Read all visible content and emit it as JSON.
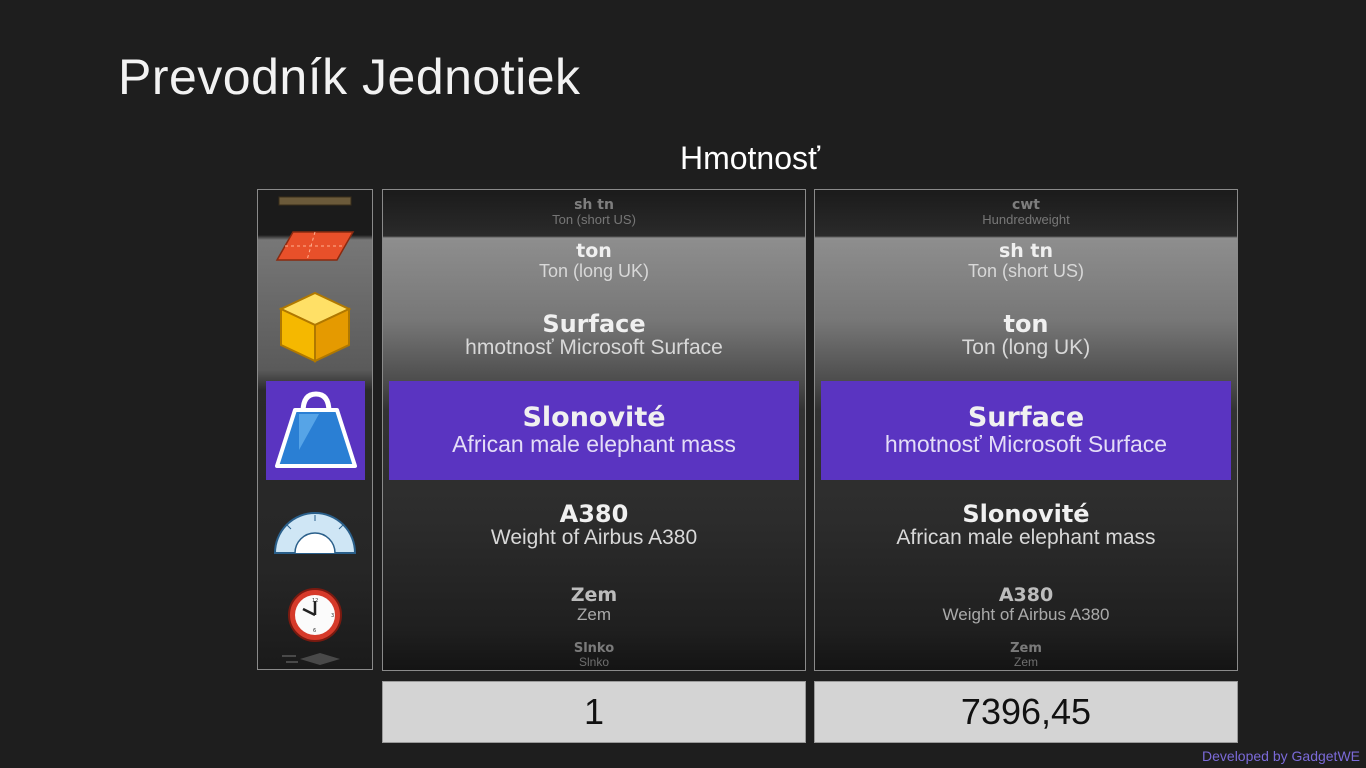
{
  "app": {
    "title": "Prevodník Jednotiek"
  },
  "category": {
    "title": "Hmotnosť"
  },
  "category_icons": [
    "ruler-icon",
    "area-icon",
    "volume-cube-icon",
    "weight-icon",
    "protractor-icon",
    "clock-icon",
    "speed-icon"
  ],
  "from_list": [
    {
      "abbr": "sh tn",
      "full": "Ton (short US)"
    },
    {
      "abbr": "ton",
      "full": "Ton (long UK)"
    },
    {
      "abbr": "Surface",
      "full": "hmotnosť Microsoft Surface"
    },
    {
      "abbr": "Slonovité",
      "full": "African male elephant mass"
    },
    {
      "abbr": "A380",
      "full": "Weight of Airbus A380"
    },
    {
      "abbr": "Zem",
      "full": "Zem"
    },
    {
      "abbr": "Slnko",
      "full": "Slnko"
    }
  ],
  "to_list": [
    {
      "abbr": "cwt",
      "full": "Hundredweight"
    },
    {
      "abbr": "sh tn",
      "full": "Ton (short US)"
    },
    {
      "abbr": "ton",
      "full": "Ton (long UK)"
    },
    {
      "abbr": "Surface",
      "full": "hmotnosť Microsoft Surface"
    },
    {
      "abbr": "Slonovité",
      "full": "African male elephant mass"
    },
    {
      "abbr": "A380",
      "full": "Weight of Airbus A380"
    },
    {
      "abbr": "Zem",
      "full": "Zem"
    }
  ],
  "input": {
    "value": "1"
  },
  "output": {
    "value": "7396,45"
  },
  "footer": {
    "credit": "Developed by GadgetWE"
  },
  "colors": {
    "accent": "#5a34c1",
    "background": "#1e1e1e",
    "credit": "#7b6ad8"
  }
}
